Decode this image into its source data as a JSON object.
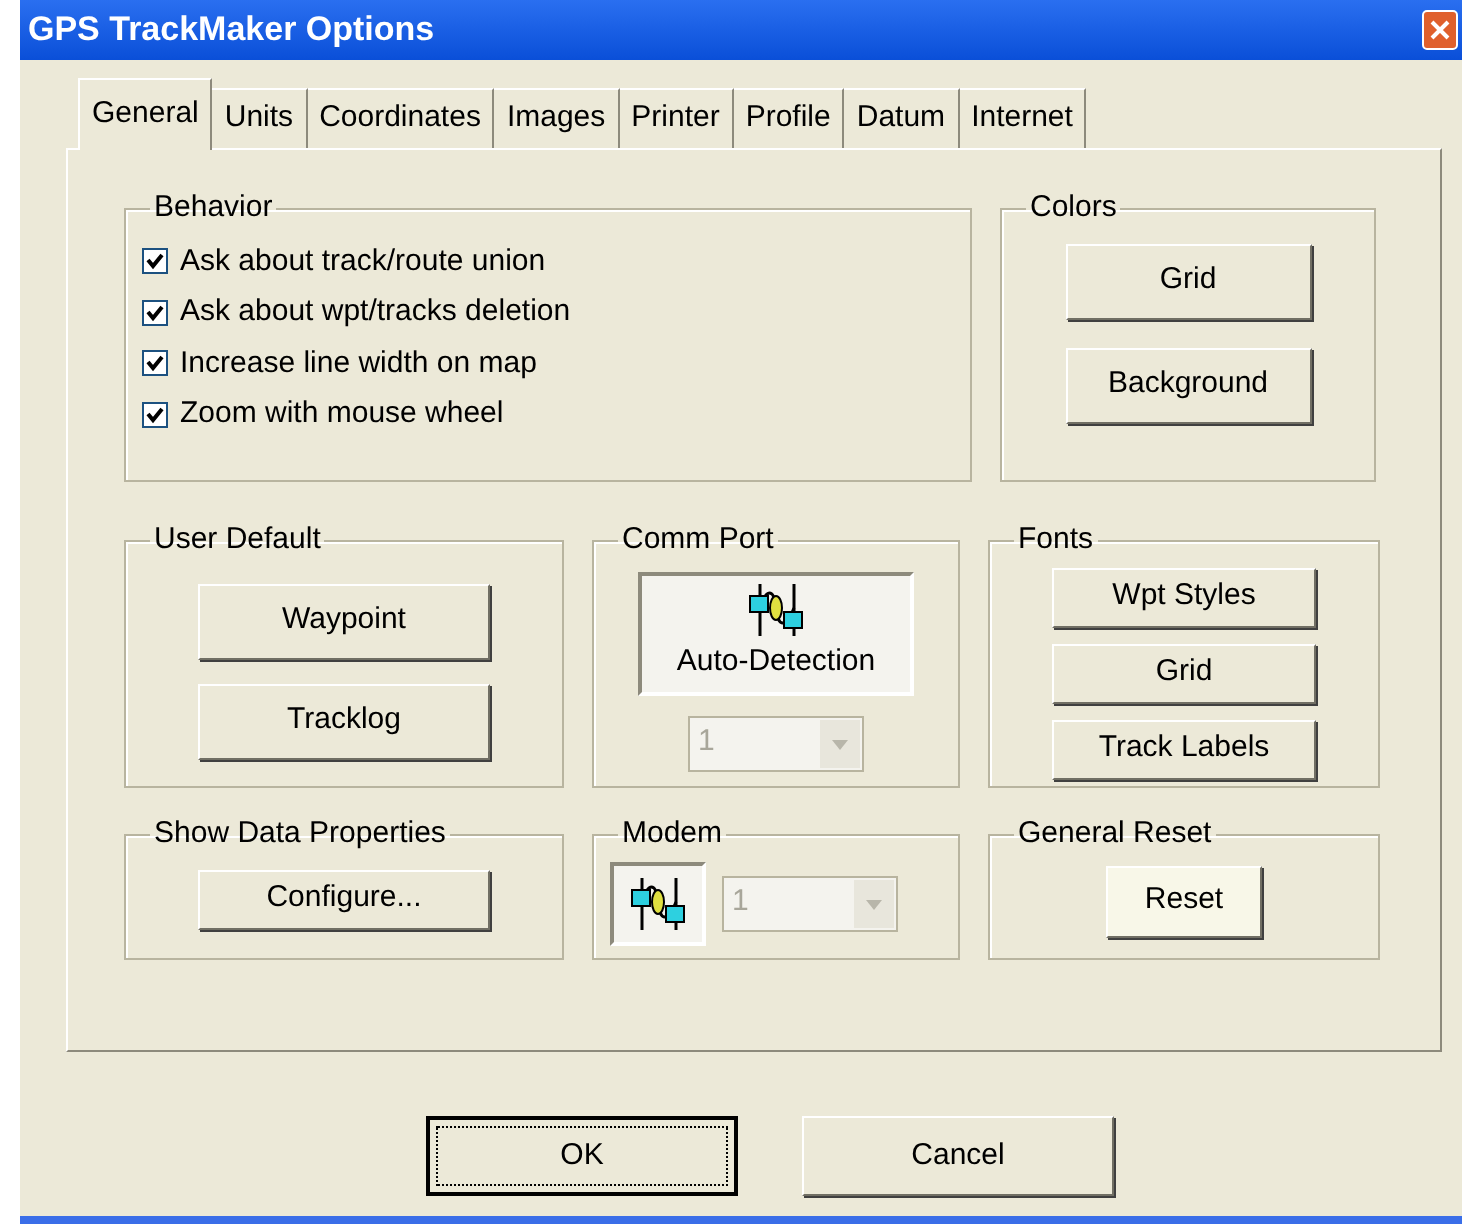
{
  "window": {
    "title": "GPS TrackMaker Options"
  },
  "tabs": [
    {
      "label": "General",
      "selected": true
    },
    {
      "label": "Units",
      "selected": false
    },
    {
      "label": "Coordinates",
      "selected": false
    },
    {
      "label": "Images",
      "selected": false
    },
    {
      "label": "Printer",
      "selected": false
    },
    {
      "label": "Profile",
      "selected": false
    },
    {
      "label": "Datum",
      "selected": false
    },
    {
      "label": "Internet",
      "selected": false
    }
  ],
  "behavior": {
    "title": "Behavior",
    "options": [
      {
        "label": "Ask about track/route union",
        "checked": true
      },
      {
        "label": "Ask about wpt/tracks deletion",
        "checked": true
      },
      {
        "label": "Increase line width on map",
        "checked": true
      },
      {
        "label": "Zoom with mouse wheel",
        "checked": true
      }
    ]
  },
  "colors": {
    "title": "Colors",
    "buttons": [
      "Grid",
      "Background"
    ]
  },
  "user_default": {
    "title": "User Default",
    "buttons": [
      "Waypoint",
      "Tracklog"
    ]
  },
  "comm_port": {
    "title": "Comm Port",
    "button": "Auto-Detection",
    "port": {
      "value": "1",
      "disabled": true
    }
  },
  "fonts": {
    "title": "Fonts",
    "buttons": [
      "Wpt Styles",
      "Grid",
      "Track Labels"
    ]
  },
  "show_data_properties": {
    "title": "Show Data Properties",
    "button": "Configure..."
  },
  "modem": {
    "title": "Modem",
    "port": {
      "value": "1",
      "disabled": true
    }
  },
  "general_reset": {
    "title": "General Reset",
    "button": "Reset"
  },
  "footer": {
    "ok": "OK",
    "cancel": "Cancel"
  }
}
